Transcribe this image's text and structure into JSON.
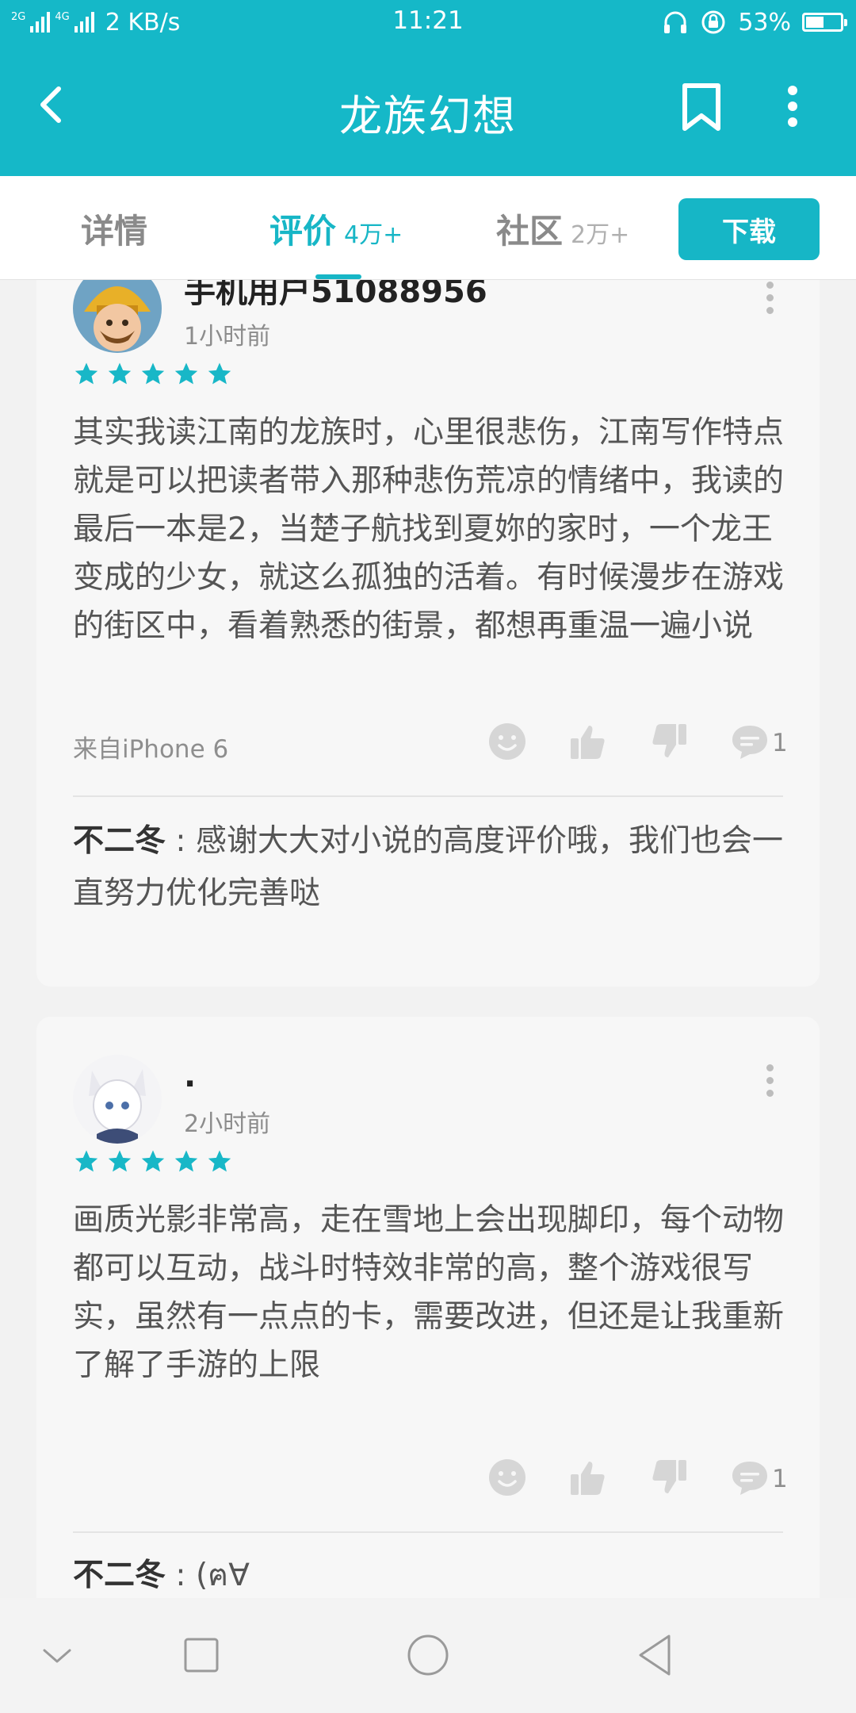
{
  "status_bar": {
    "net_tag_1": "2G",
    "net_tag_2": "4G",
    "speed": "2 KB/s",
    "time": "11:21",
    "battery": "53%"
  },
  "app": {
    "title": "龙族幻想"
  },
  "tabs": [
    {
      "label": "详情",
      "count": ""
    },
    {
      "label": "评价",
      "count": "4万+",
      "active": true
    },
    {
      "label": "社区",
      "count": "2万+"
    }
  ],
  "download_label": "下载",
  "reviews": [
    {
      "username": "手机用户51088956",
      "time": "1小时前",
      "stars": 5,
      "text": "其实我读江南的龙族时，心里很悲伤，江南写作特点就是可以把读者带入那种悲伤荒凉的情绪中，我读的最后一本是2，当楚子航找到夏妳的家时，一个龙王变成的少女，就这么孤独的活着。有时候漫步在游戏的街区中，看着熟悉的街景，都想再重温一遍小说",
      "device": "来自iPhone 6",
      "reply_count": "1",
      "reply_author": "不二冬",
      "reply_text": "感谢大大对小说的高度评价哦，我们也会一直努力优化完善哒"
    },
    {
      "username": ".",
      "time": "2小时前",
      "stars": 5,
      "text": "画质光影非常高，走在雪地上会出现脚印，每个动物都可以互动，战斗时特效非常的高，整个游戏很写实，虽然有一点点的卡，需要改进，但还是让我重新了解了手游的上限",
      "device": "",
      "reply_count": "1",
      "reply_author": "不二冬",
      "reply_text": "(ฅ∀"
    }
  ],
  "colors": {
    "accent": "#15b8c8",
    "star": "#18b7c7",
    "card_bg": "#f7f7f7"
  },
  "icons": {
    "back": "chevron-left-icon",
    "bookmark": "bookmark-icon",
    "more": "more-vertical-icon",
    "emoji": "smiley-icon",
    "like": "thumbs-up-icon",
    "dislike": "thumbs-down-icon",
    "comment": "comment-icon"
  }
}
